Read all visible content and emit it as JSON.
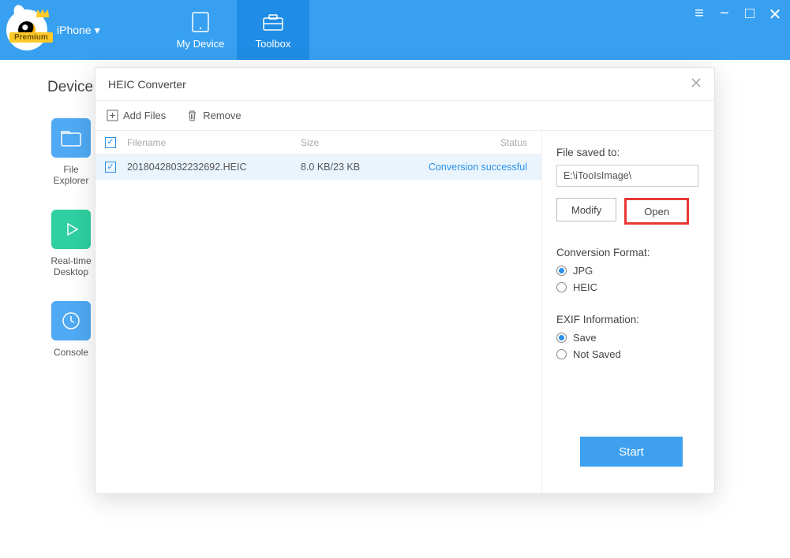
{
  "header": {
    "device_label": "iPhone",
    "premium_badge": "Premium",
    "tabs": [
      {
        "label": "My Device"
      },
      {
        "label": "Toolbox"
      }
    ]
  },
  "background": {
    "section_title": "Device",
    "tiles": [
      {
        "label": "File\nExplorer"
      },
      {
        "label": "Real-time\nDesktop"
      },
      {
        "label": "Console"
      }
    ]
  },
  "dialog": {
    "title": "HEIC Converter",
    "toolbar": {
      "add_files": "Add Files",
      "remove": "Remove"
    },
    "columns": {
      "filename": "Filename",
      "size": "Size",
      "status": "Status"
    },
    "rows": [
      {
        "filename": "20180428032232692.HEIC",
        "size": "8.0 KB/23 KB",
        "status": "Conversion successful"
      }
    ],
    "side": {
      "saved_to_label": "File saved to:",
      "saved_to_path": "E:\\iTooIsImage\\",
      "modify": "Modify",
      "open": "Open",
      "format_label": "Conversion Format:",
      "format_options": [
        "JPG",
        "HEIC"
      ],
      "format_selected": "JPG",
      "exif_label": "EXIF Information:",
      "exif_options": [
        "Save",
        "Not Saved"
      ],
      "exif_selected": "Save",
      "start": "Start"
    }
  }
}
